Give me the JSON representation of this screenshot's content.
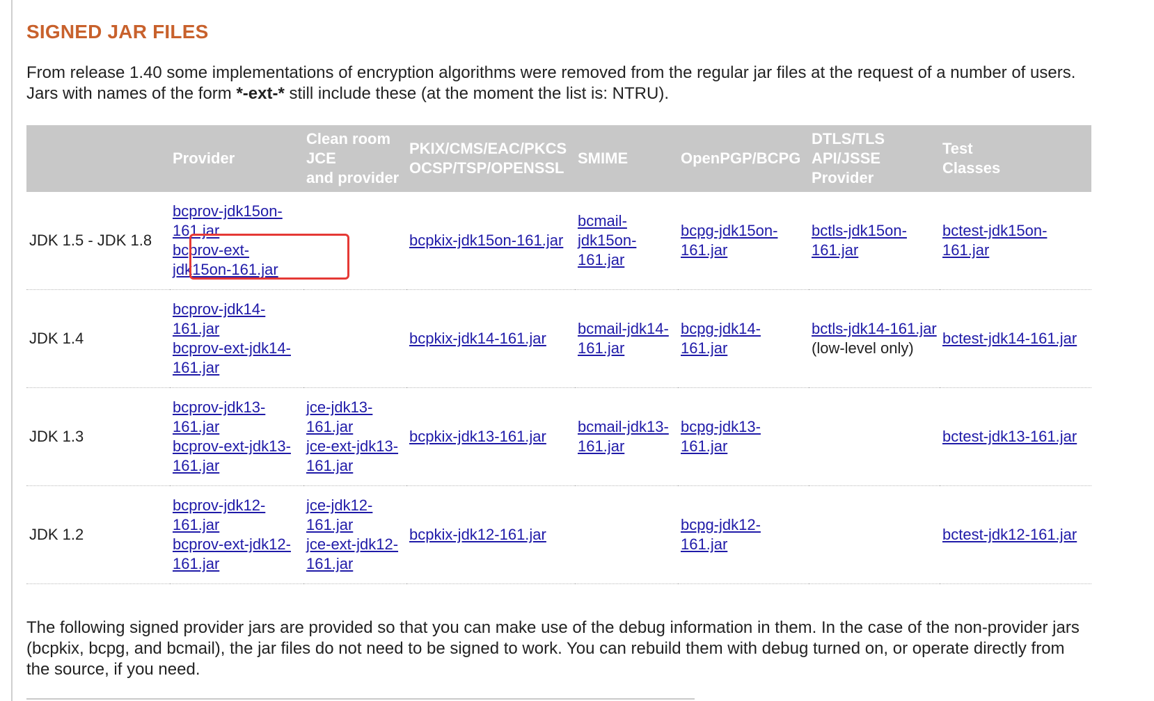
{
  "section": {
    "title": "SIGNED JAR FILES",
    "intro_part1": "From release 1.40 some implementations of encryption algorithms were removed from the regular jar files at the request of a number of users. Jars with names of the form ",
    "intro_bold": "*-ext-*",
    "intro_part2": " still include these (at the moment the list is: NTRU).",
    "outro": "The following signed provider jars are provided so that you can make use of the debug information in them. In the case of the non-provider jars (bcpkix, bcpg, and bcmail), the jar files do not need to be signed to work. You can rebuild them with debug turned on, or operate directly from the source, if you need."
  },
  "table": {
    "headers": {
      "jdk": "",
      "provider": "Provider",
      "clean_room_l1": "Clean room",
      "clean_room_l2": "JCE",
      "clean_room_l3": "and provider",
      "pkix_l1": "PKIX/CMS/EAC/PKCS",
      "pkix_l2": "OCSP/TSP/OPENSSL",
      "smime": "SMIME",
      "openpgp": "OpenPGP/BCPG",
      "dtls_l1": "DTLS/TLS",
      "dtls_l2": "API/JSSE",
      "dtls_l3": "Provider",
      "test_l1": "Test",
      "test_l2": "Classes"
    },
    "rows": [
      {
        "jdk": "JDK 1.5 - JDK 1.8",
        "provider": [
          "bcprov-jdk15on-161.jar",
          "bcprov-ext-jdk15on-161.jar"
        ],
        "clean_room": [],
        "pkix": "bcpkix-jdk15on-161.jar",
        "smime": "bcmail-jdk15on-161.jar",
        "openpgp": "bcpg-jdk15on-161.jar",
        "dtls": "bctls-jdk15on-161.jar",
        "dtls_note": "",
        "test": "bctest-jdk15on-161.jar"
      },
      {
        "jdk": "JDK 1.4",
        "provider": [
          "bcprov-jdk14-161.jar",
          "bcprov-ext-jdk14-161.jar"
        ],
        "clean_room": [],
        "pkix": "bcpkix-jdk14-161.jar",
        "smime": "bcmail-jdk14-161.jar",
        "openpgp": "bcpg-jdk14-161.jar",
        "dtls": "bctls-jdk14-161.jar",
        "dtls_note": " (low-level only)",
        "test": "bctest-jdk14-161.jar"
      },
      {
        "jdk": "JDK 1.3",
        "provider": [
          "bcprov-jdk13-161.jar",
          "bcprov-ext-jdk13-161.jar"
        ],
        "clean_room": [
          "jce-jdk13-161.jar",
          "jce-ext-jdk13-161.jar"
        ],
        "pkix": "bcpkix-jdk13-161.jar",
        "smime": "bcmail-jdk13-161.jar",
        "openpgp": "bcpg-jdk13-161.jar",
        "dtls": "",
        "dtls_note": "",
        "test": "bctest-jdk13-161.jar"
      },
      {
        "jdk": "JDK 1.2",
        "provider": [
          "bcprov-jdk12-161.jar",
          "bcprov-ext-jdk12-161.jar"
        ],
        "clean_room": [
          "jce-jdk12-161.jar",
          "jce-ext-jdk12-161.jar"
        ],
        "pkix": "bcpkix-jdk12-161.jar",
        "smime": "",
        "openpgp": "bcpg-jdk12-161.jar",
        "dtls": "",
        "dtls_note": "",
        "test": "bctest-jdk12-161.jar"
      }
    ]
  },
  "colors": {
    "title": "#c8612c",
    "header_bg": "#c8c8c8",
    "link": "#1f1aa8",
    "highlight": "#e53935"
  }
}
